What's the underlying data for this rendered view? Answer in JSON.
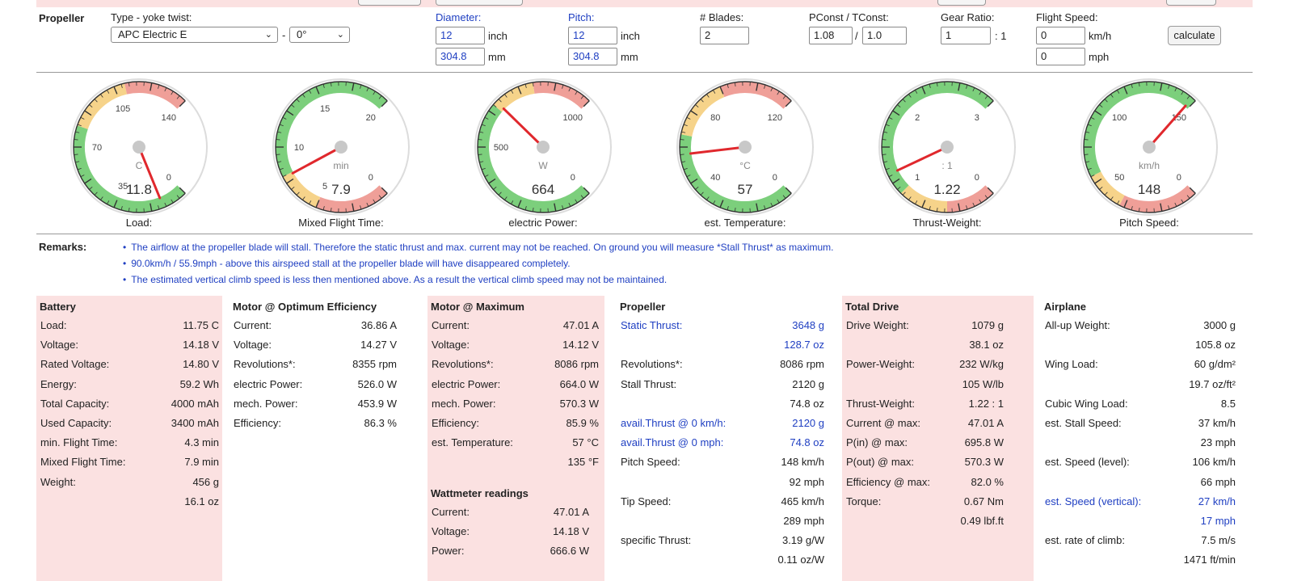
{
  "propeller": {
    "section_label": "Propeller",
    "type_label": "Type - yoke twist:",
    "type_value": "APC Electric E",
    "dash": "-",
    "twist_value": "0°",
    "diameter_label": "Diameter:",
    "diameter_inch": "12",
    "diameter_mm": "304.8",
    "pitch_label": "Pitch:",
    "pitch_inch": "12",
    "pitch_mm": "304.8",
    "unit_inch": "inch",
    "unit_mm": "mm",
    "blades_label": "# Blades:",
    "blades_value": "2",
    "pconst_label": "PConst / TConst:",
    "pconst_value": "1.08",
    "slash": "/",
    "tconst_value": "1.0",
    "gear_label": "Gear Ratio:",
    "gear_value": "1",
    "gear_suffix": ": 1",
    "speed_label": "Flight Speed:",
    "speed_kmh": "0",
    "speed_mph": "0",
    "unit_kmh": "km/h",
    "unit_mph": "mph",
    "calculate_label": "calculate"
  },
  "gauges": [
    {
      "caption": "Load:",
      "unit": "C",
      "value_text": "11.8",
      "ticks": [
        "0",
        "35",
        "70",
        "105",
        "140"
      ],
      "min": 0,
      "max": 140,
      "value": 11.8,
      "bands": [
        {
          "from": 0,
          "to": 80,
          "color": "#7ccf7c"
        },
        {
          "from": 80,
          "to": 110,
          "color": "#f6d38a"
        },
        {
          "from": 110,
          "to": 140,
          "color": "#ef9f98"
        }
      ]
    },
    {
      "caption": "Mixed Flight Time:",
      "unit": "min",
      "value_text": "7.9",
      "ticks": [
        "0",
        "5",
        "10",
        "15",
        "20"
      ],
      "min": 0,
      "max": 20,
      "value": 7.9,
      "bands": [
        {
          "from": 0,
          "to": 5,
          "color": "#ef9f98"
        },
        {
          "from": 5,
          "to": 8,
          "color": "#f6d38a"
        },
        {
          "from": 8,
          "to": 20,
          "color": "#7ccf7c"
        }
      ]
    },
    {
      "caption": "electric Power:",
      "unit": "W",
      "value_text": "664",
      "ticks": [
        "0",
        "500",
        "1000"
      ],
      "min": 0,
      "max": 1000,
      "value": 664,
      "bands": [
        {
          "from": 0,
          "to": 650,
          "color": "#7ccf7c"
        },
        {
          "from": 650,
          "to": 800,
          "color": "#f6d38a"
        },
        {
          "from": 800,
          "to": 1000,
          "color": "#ef9f98"
        }
      ]
    },
    {
      "caption": "est. Temperature:",
      "unit": "°C",
      "value_text": "57",
      "ticks": [
        "0",
        "40",
        "80",
        "120"
      ],
      "min": 0,
      "max": 120,
      "value": 57,
      "bands": [
        {
          "from": 0,
          "to": 65,
          "color": "#7ccf7c"
        },
        {
          "from": 65,
          "to": 90,
          "color": "#f6d38a"
        },
        {
          "from": 90,
          "to": 120,
          "color": "#ef9f98"
        }
      ]
    },
    {
      "caption": "Thrust-Weight:",
      "unit": ": 1",
      "value_text": "1.22",
      "ticks": [
        "0",
        "1",
        "2",
        "3"
      ],
      "min": 0,
      "max": 3,
      "value": 1.22,
      "bands": [
        {
          "from": 0,
          "to": 0.5,
          "color": "#ef9f98"
        },
        {
          "from": 0.5,
          "to": 1,
          "color": "#f6d38a"
        },
        {
          "from": 1,
          "to": 3,
          "color": "#7ccf7c"
        }
      ]
    },
    {
      "caption": "Pitch Speed:",
      "unit": "km/h",
      "value_text": "148",
      "ticks": [
        "0",
        "50",
        "100",
        "150"
      ],
      "min": 0,
      "max": 150,
      "value": 148,
      "bands": [
        {
          "from": 0,
          "to": 40,
          "color": "#ef9f98"
        },
        {
          "from": 40,
          "to": 60,
          "color": "#f6d38a"
        },
        {
          "from": 60,
          "to": 150,
          "color": "#7ccf7c"
        }
      ]
    }
  ],
  "remarks": {
    "label": "Remarks:",
    "items": [
      "The airflow at the propeller blade will stall. Therefore the static thrust and max. current may not be reached. On ground you will measure *Stall Thrust* as maximum.",
      "90.0km/h / 55.9mph - above this airspeed stall at the propeller blade will have disappeared completely.",
      "The estimated vertical climb speed is less then mentioned above. As a result the vertical climb speed may not be maintained."
    ]
  },
  "battery": {
    "title": "Battery",
    "rows": [
      {
        "k": "Load:",
        "v": "11.75 C"
      },
      {
        "k": "Voltage:",
        "v": "14.18 V"
      },
      {
        "k": "Rated Voltage:",
        "v": "14.80 V"
      },
      {
        "k": "Energy:",
        "v": "59.2 Wh"
      },
      {
        "k": "Total Capacity:",
        "v": "4000 mAh"
      },
      {
        "k": "Used Capacity:",
        "v": "3400 mAh"
      },
      {
        "k": "min. Flight Time:",
        "v": "4.3 min"
      },
      {
        "k": "Mixed Flight Time:",
        "v": "7.9 min"
      },
      {
        "k": "Weight:",
        "v": "456 g"
      },
      {
        "k": "",
        "v": "16.1 oz"
      }
    ]
  },
  "motor_opt": {
    "title": "Motor @ Optimum Efficiency",
    "rows": [
      {
        "k": "Current:",
        "v": "36.86 A"
      },
      {
        "k": "Voltage:",
        "v": "14.27 V"
      },
      {
        "k": "Revolutions*:",
        "v": "8355 rpm"
      },
      {
        "k": "electric Power:",
        "v": "526.0 W"
      },
      {
        "k": "mech. Power:",
        "v": "453.9 W"
      },
      {
        "k": "Efficiency:",
        "v": "86.3 %"
      }
    ]
  },
  "motor_max": {
    "title": "Motor @ Maximum",
    "rows": [
      {
        "k": "Current:",
        "v": "47.01 A"
      },
      {
        "k": "Voltage:",
        "v": "14.12 V"
      },
      {
        "k": "Revolutions*:",
        "v": "8086 rpm"
      },
      {
        "k": "electric Power:",
        "v": "664.0 W"
      },
      {
        "k": "mech. Power:",
        "v": "570.3 W"
      },
      {
        "k": "Efficiency:",
        "v": "85.9 %"
      },
      {
        "k": "est. Temperature:",
        "v": "57 °C"
      },
      {
        "k": "",
        "v": "135 °F"
      }
    ],
    "watt_title": "Wattmeter readings",
    "watt_rows": [
      {
        "k": "Current:",
        "v": "47.01 A"
      },
      {
        "k": "Voltage:",
        "v": "14.18 V"
      },
      {
        "k": "Power:",
        "v": "666.6 W"
      }
    ]
  },
  "prop_results": {
    "title": "Propeller",
    "rows": [
      {
        "k": "Static Thrust:",
        "v": "3648 g",
        "blue": true
      },
      {
        "k": "",
        "v": "128.7 oz",
        "blue": true
      },
      {
        "k": "Revolutions*:",
        "v": "8086 rpm"
      },
      {
        "k": "Stall Thrust:",
        "v": "2120 g"
      },
      {
        "k": "",
        "v": "74.8 oz"
      },
      {
        "k": "avail.Thrust @ 0 km/h:",
        "v": "2120 g",
        "blue": true
      },
      {
        "k": "avail.Thrust @ 0 mph:",
        "v": "74.8 oz",
        "blue": true
      },
      {
        "k": "Pitch Speed:",
        "v": "148 km/h"
      },
      {
        "k": "",
        "v": "92 mph"
      },
      {
        "k": "Tip Speed:",
        "v": "465 km/h"
      },
      {
        "k": "",
        "v": "289 mph"
      },
      {
        "k": "specific Thrust:",
        "v": "3.19 g/W"
      },
      {
        "k": "",
        "v": "0.11 oz/W"
      }
    ]
  },
  "total_drive": {
    "title": "Total Drive",
    "rows": [
      {
        "k": "Drive Weight:",
        "v": "1079 g"
      },
      {
        "k": "",
        "v": "38.1 oz"
      },
      {
        "k": "Power-Weight:",
        "v": "232 W/kg"
      },
      {
        "k": "",
        "v": "105 W/lb"
      },
      {
        "k": "Thrust-Weight:",
        "v": "1.22 : 1"
      },
      {
        "k": "Current @ max:",
        "v": "47.01 A"
      },
      {
        "k": "P(in) @ max:",
        "v": "695.8 W"
      },
      {
        "k": "P(out) @ max:",
        "v": "570.3 W"
      },
      {
        "k": "Efficiency @ max:",
        "v": "82.0 %"
      },
      {
        "k": "Torque:",
        "v": "0.67 Nm"
      },
      {
        "k": "",
        "v": "0.49 lbf.ft"
      }
    ]
  },
  "airplane": {
    "title": "Airplane",
    "rows": [
      {
        "k": "All-up Weight:",
        "v": "3000 g"
      },
      {
        "k": "",
        "v": "105.8 oz"
      },
      {
        "k": "Wing Load:",
        "v": "60 g/dm²"
      },
      {
        "k": "",
        "v": "19.7 oz/ft²"
      },
      {
        "k": "Cubic Wing Load:",
        "v": "8.5"
      },
      {
        "k": "est. Stall Speed:",
        "v": "37 km/h"
      },
      {
        "k": "",
        "v": "23 mph"
      },
      {
        "k": "est. Speed (level):",
        "v": "106 km/h"
      },
      {
        "k": "",
        "v": "66 mph"
      },
      {
        "k": "est. Speed (vertical):",
        "v": "27 km/h",
        "blue": true
      },
      {
        "k": "",
        "v": "17 mph",
        "blue": true
      },
      {
        "k": "est. rate of climb:",
        "v": "7.5 m/s"
      },
      {
        "k": "",
        "v": "1471 ft/min"
      }
    ]
  }
}
